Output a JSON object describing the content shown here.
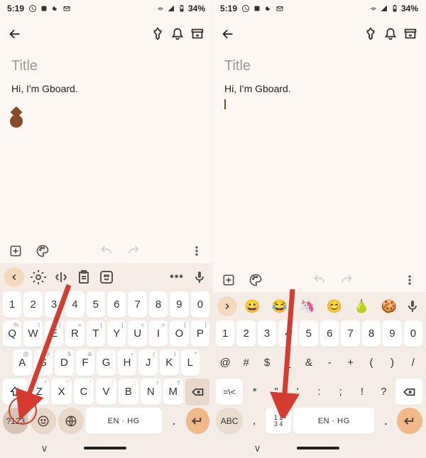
{
  "status": {
    "time": "5:19",
    "battery": "34%"
  },
  "note": {
    "title_placeholder": "Title",
    "body": "Hi, I'm Gboard."
  },
  "qwerty": {
    "row_num": [
      "1",
      "2",
      "3",
      "4",
      "5",
      "6",
      "7",
      "8",
      "9",
      "0"
    ],
    "row1": [
      "Q",
      "W",
      "E",
      "R",
      "T",
      "Y",
      "U",
      "I",
      "O",
      "P"
    ],
    "row1_hints": [
      "%",
      "\\",
      "|",
      "=",
      "[",
      "]",
      "<",
      ">",
      "{",
      "}"
    ],
    "row2": [
      "A",
      "S",
      "D",
      "F",
      "G",
      "H",
      "J",
      "K",
      "L"
    ],
    "row2_hints": [
      "@",
      "#",
      "$",
      "&",
      "-",
      "+",
      "(",
      ")",
      "*"
    ],
    "row3": [
      "Z",
      "X",
      "C",
      "V",
      "B",
      "N",
      "M"
    ],
    "row3_hints": [
      "*",
      "\"",
      "'",
      ":",
      ";",
      "!",
      "?"
    ],
    "mode_key": "?123",
    "space_label": "EN · HG"
  },
  "symbols": {
    "row_num": [
      "1",
      "2",
      "3",
      "4",
      "5",
      "6",
      "7",
      "8",
      "9",
      "0"
    ],
    "row_sym1": [
      "@",
      "#",
      "$",
      "_",
      "&",
      "-",
      "+",
      "(",
      ")",
      "/"
    ],
    "more_key": "=\\<",
    "row_sym2": [
      "*",
      "\"",
      "'",
      ":",
      ";",
      "!",
      "?"
    ],
    "mode_key": "ABC",
    "numpad_key": "12\n34",
    "space_label": "EN · HG"
  },
  "emoji_strip": [
    "😀",
    "😂",
    "🦄",
    "😊",
    "🍐",
    "🍪"
  ],
  "icons": {
    "back": "back-arrow",
    "pin": "pin",
    "bell": "bell",
    "archive": "archive",
    "add_box": "add-box",
    "palette": "palette",
    "undo": "undo",
    "redo": "redo",
    "more": "more-vert",
    "chev_left": "chevron-left",
    "chev_right": "chevron-right",
    "gear": "gear",
    "cursor_control": "cursor-control",
    "clipboard": "clipboard",
    "sticker": "sticker",
    "mic": "mic",
    "shift": "shift",
    "backspace": "backspace",
    "emoji": "emoji",
    "globe": "globe",
    "enter": "enter"
  }
}
